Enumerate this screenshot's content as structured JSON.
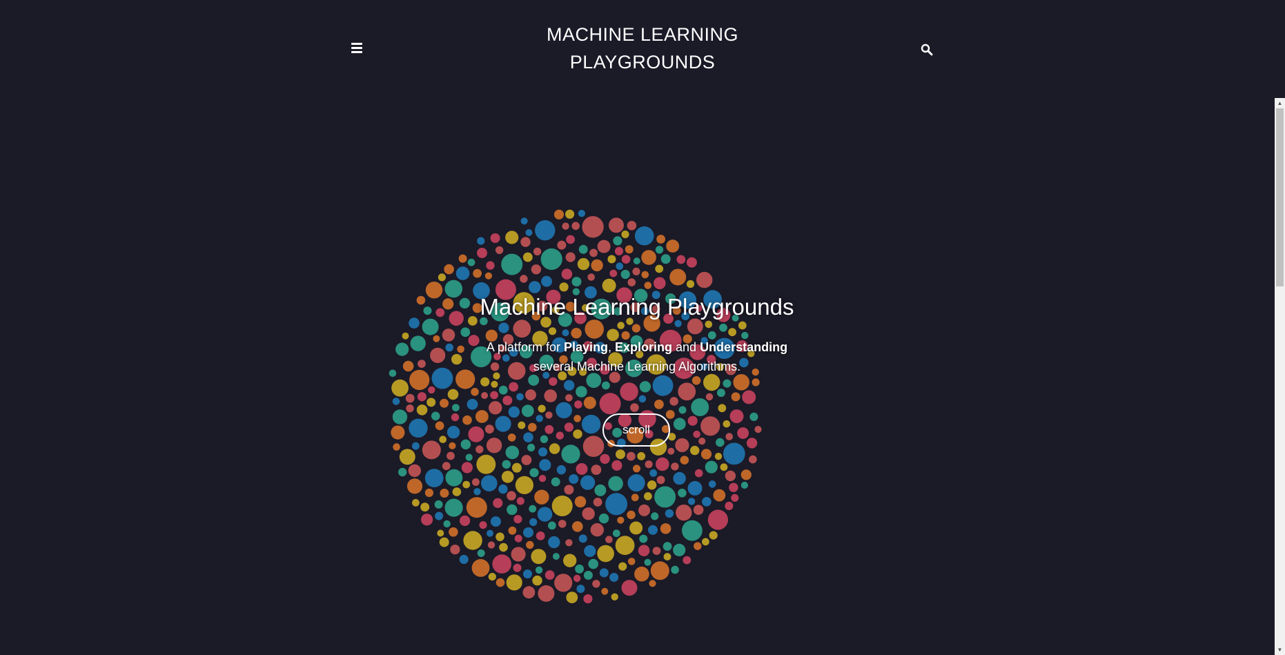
{
  "header": {
    "menu_icon": "hamburger-menu-icon",
    "title_line1": "MACHINE LEARNING",
    "title_line2": "PLAYGROUNDS",
    "search_icon": "search-icon"
  },
  "hero": {
    "title": "Machine Learning Playgrounds",
    "subtitle_prefix": "A platform for ",
    "subtitle_bold1": "Playing",
    "subtitle_sep1": ", ",
    "subtitle_bold2": "Exploring",
    "subtitle_sep2": " and ",
    "subtitle_bold3": "Understanding",
    "subtitle_line2": "several Machine Learning Algorithms.",
    "button_label": "scroll"
  },
  "colors": {
    "background": "#1b1a27",
    "bubble_palette": [
      "#1f77b4",
      "#2ca089",
      "#c8a825",
      "#d0702a",
      "#c8425e",
      "#c45556"
    ]
  }
}
